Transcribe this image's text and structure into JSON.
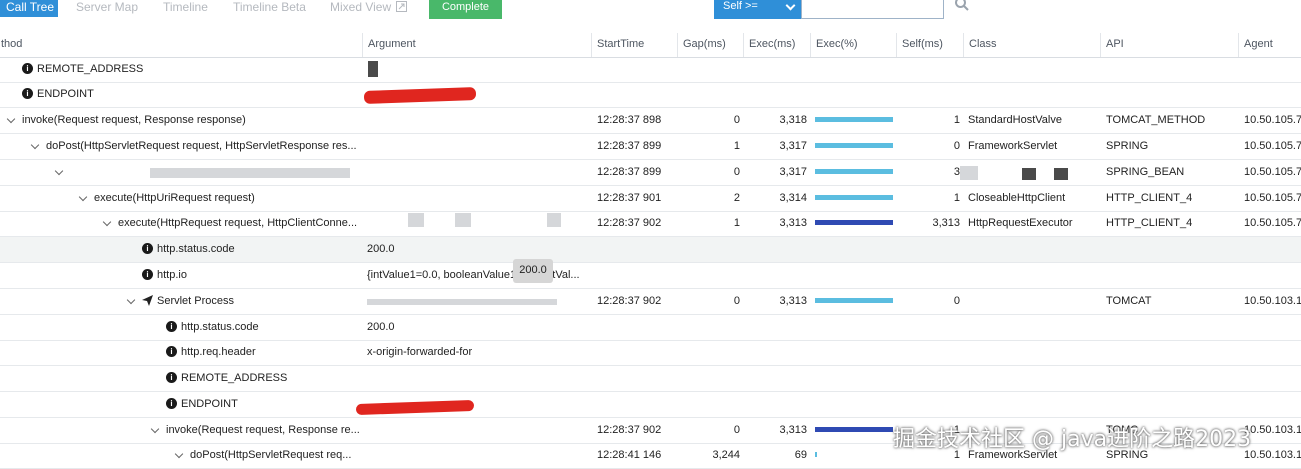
{
  "tabs": [
    {
      "label": "Call Tree",
      "active": true
    },
    {
      "label": "Server Map"
    },
    {
      "label": "Timeline"
    },
    {
      "label": "Timeline Beta"
    },
    {
      "label": "Mixed View"
    }
  ],
  "complete_label": "Complete",
  "self_filter": {
    "label": "Self >=",
    "value": ""
  },
  "columns": {
    "method": "thod",
    "argument": "Argument",
    "start": "StartTime",
    "gap": "Gap(ms)",
    "exec": "Exec(ms)",
    "execp": "Exec(%)",
    "self": "Self(ms)",
    "class": "Class",
    "api": "API",
    "agent": "Agent"
  },
  "rows": [
    {
      "icon": "info",
      "method": "REMOTE_ADDRESS"
    },
    {
      "icon": "info",
      "method": "ENDPOINT"
    },
    {
      "icon": "toggle",
      "method": "invoke(Request request, Response response)",
      "start": "12:28:37 898",
      "gap": "0",
      "exec": "3,318",
      "exec_pct": 0.95,
      "bar": "light",
      "self": "1",
      "class": "StandardHostValve",
      "api": "TOMCAT_METHOD",
      "agent": "10.50.105.7"
    },
    {
      "icon": "toggle",
      "method": "doPost(HttpServletRequest request, HttpServletResponse res...",
      "start": "12:28:37 899",
      "gap": "1",
      "exec": "3,317",
      "exec_pct": 0.95,
      "bar": "light",
      "self": "0",
      "class": "FrameworkServlet",
      "api": "SPRING",
      "agent": "10.50.105.7"
    },
    {
      "icon": "toggle",
      "method": "",
      "start": "12:28:37 899",
      "gap": "0",
      "exec": "3,317",
      "exec_pct": 0.95,
      "bar": "light",
      "self": "3",
      "class": "",
      "api": "SPRING_BEAN",
      "agent": "10.50.105.7"
    },
    {
      "icon": "toggle",
      "method": "execute(HttpUriRequest request)",
      "start": "12:28:37 901",
      "gap": "2",
      "exec": "3,314",
      "exec_pct": 0.95,
      "bar": "light",
      "self": "1",
      "class": "CloseableHttpClient",
      "api": "HTTP_CLIENT_4",
      "agent": "10.50.105.7"
    },
    {
      "icon": "toggle",
      "method": "execute(HttpRequest request, HttpClientConne...",
      "start": "12:28:37 902",
      "gap": "1",
      "exec": "3,313",
      "exec_pct": 0.95,
      "bar": "dark",
      "self": "3,313",
      "class": "HttpRequestExecutor",
      "api": "HTTP_CLIENT_4",
      "agent": "10.50.105.7"
    },
    {
      "icon": "info",
      "method": "http.status.code",
      "arg": "200.0",
      "hl": true
    },
    {
      "icon": "info",
      "method": "http.io",
      "arg": "{intValue1=0.0, booleanValue1",
      "arg_tail": "ntVal..."
    },
    {
      "icon": "plane",
      "method": "Servlet Process",
      "start": "12:28:37 902",
      "gap": "0",
      "exec": "3,313",
      "exec_pct": 0.95,
      "bar": "light",
      "self": "0",
      "api": "TOMCAT",
      "agent": "10.50.103.1"
    },
    {
      "icon": "info",
      "method": "http.status.code",
      "arg": "200.0"
    },
    {
      "icon": "info",
      "method": "http.req.header",
      "arg": "x-origin-forwarded-for"
    },
    {
      "icon": "info",
      "method": "REMOTE_ADDRESS"
    },
    {
      "icon": "info",
      "method": "ENDPOINT"
    },
    {
      "icon": "toggle",
      "method": "invoke(Request request, Response re...",
      "start": "12:28:37 902",
      "gap": "0",
      "exec": "3,313",
      "exec_pct": 0.95,
      "bar": "dark",
      "self": "1",
      "class": "",
      "api": "TOMC",
      "agent": "10.50.103.1"
    },
    {
      "icon": "toggle",
      "method": "doPost(HttpServletRequest req...",
      "start": "12:28:41 146",
      "gap": "3,244",
      "exec": "69",
      "exec_pct": 0.02,
      "bar": "light",
      "self": "1",
      "class": "FrameworkServlet",
      "api": "SPRING",
      "agent": "10.50.103.1"
    }
  ],
  "tooltip": "200.0",
  "watermark": "掘金技术社区 @ java进阶之路2023"
}
